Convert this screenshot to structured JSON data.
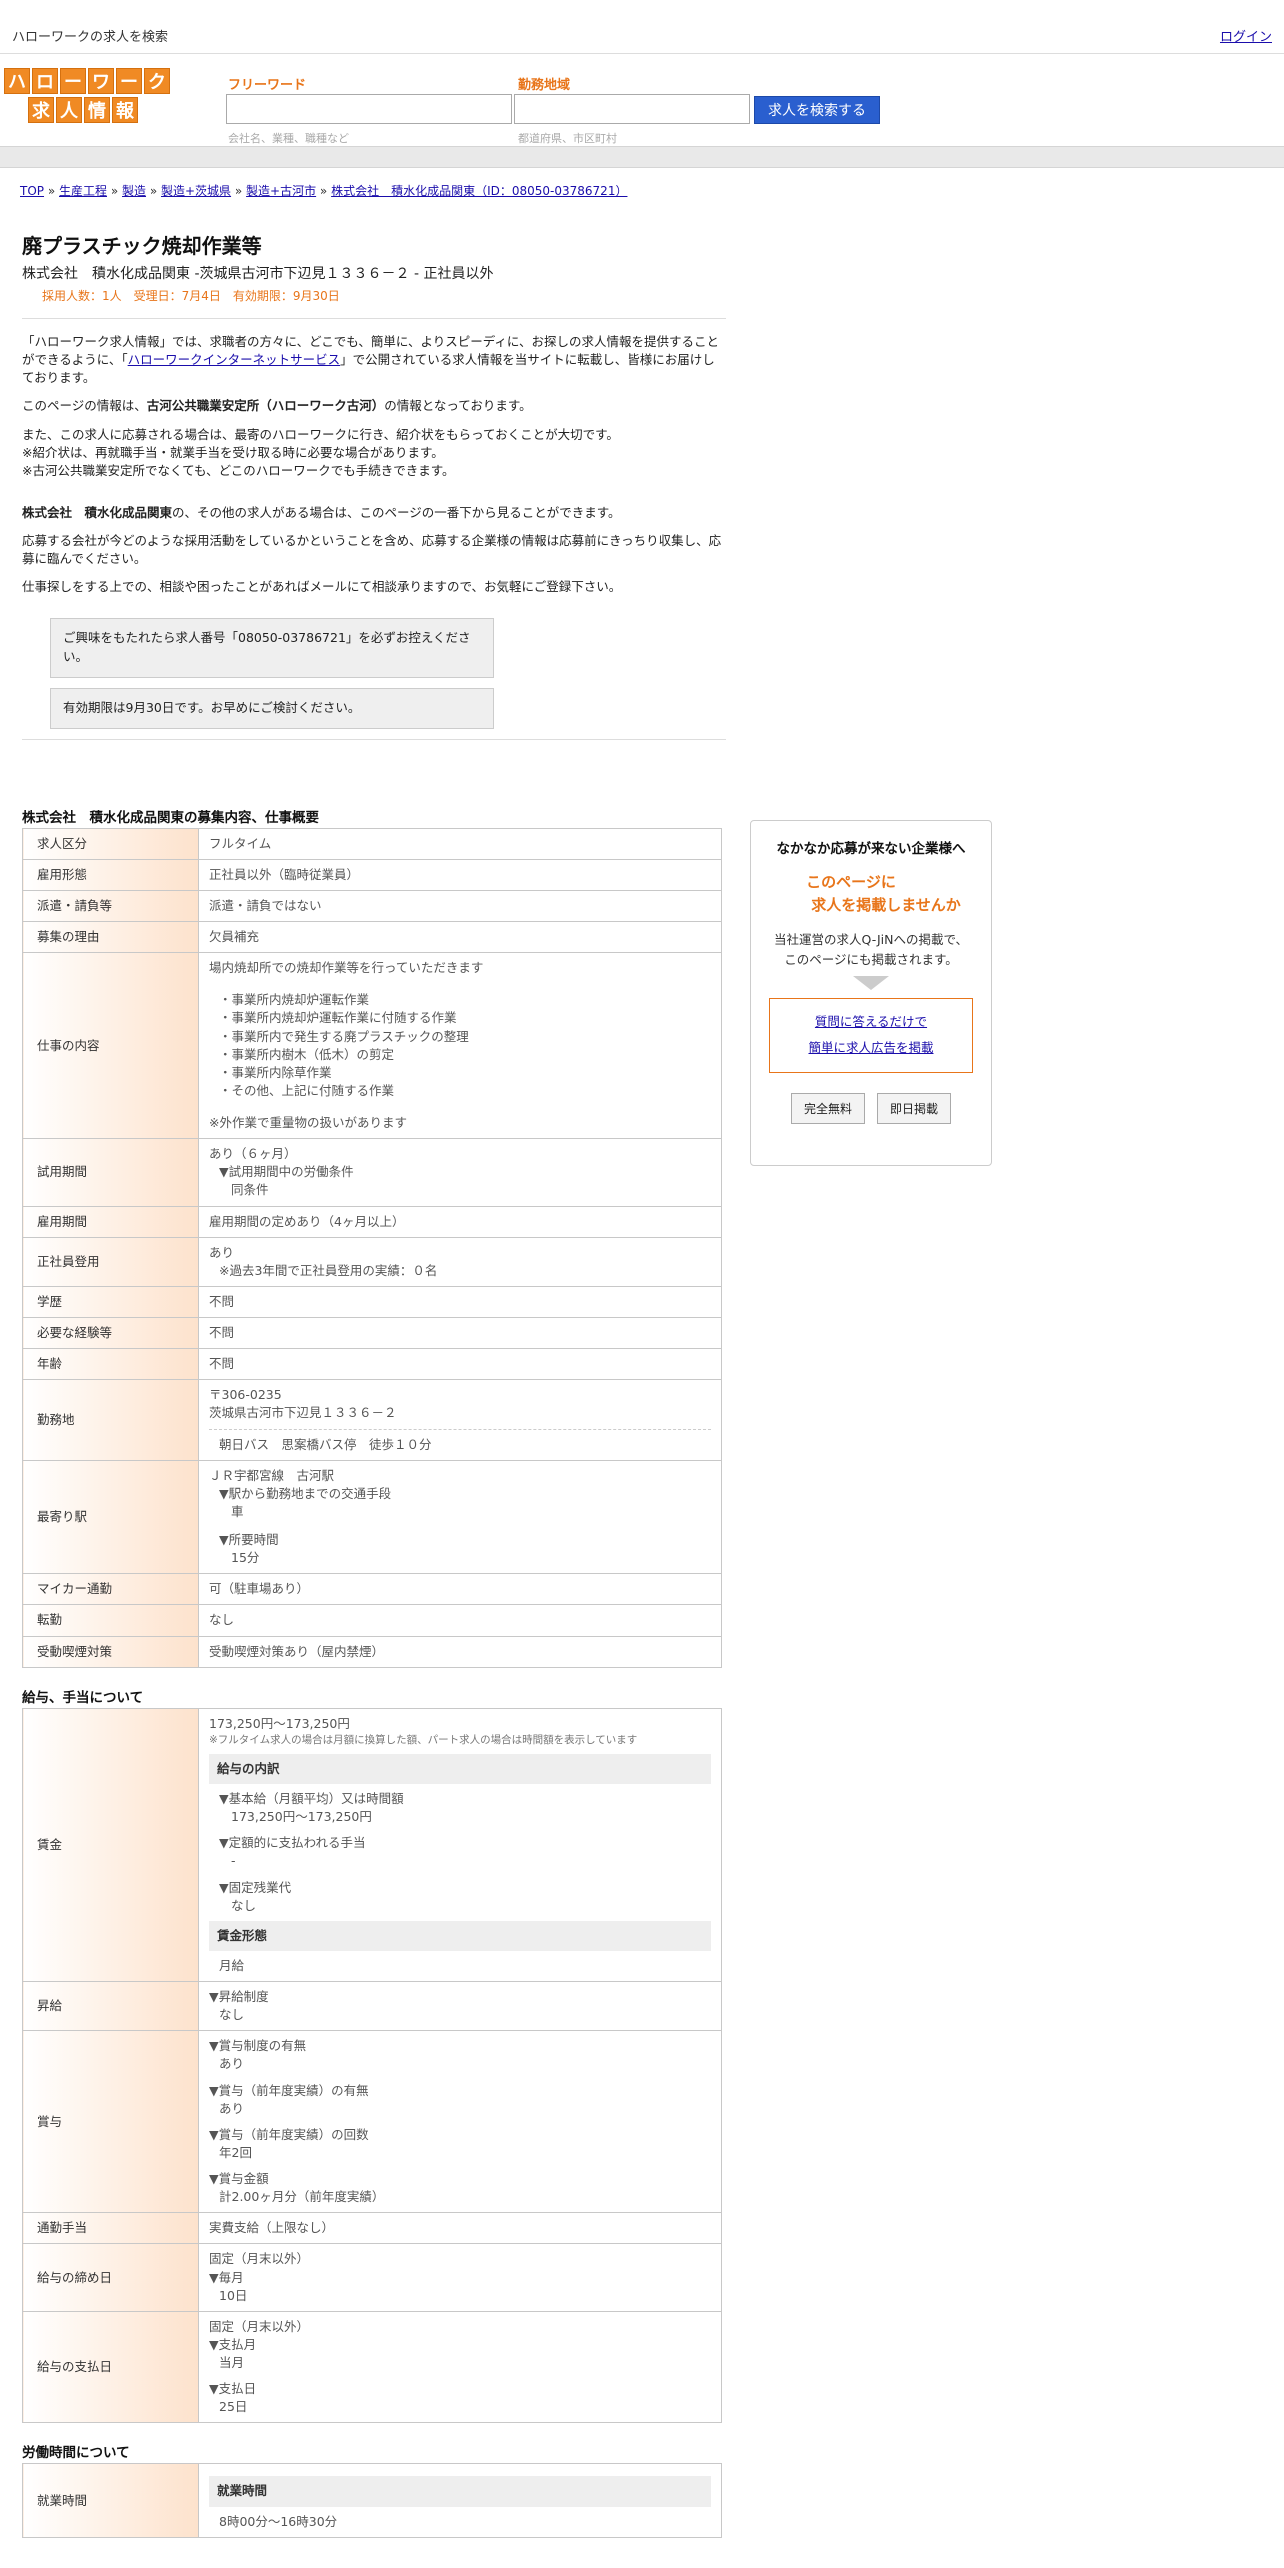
{
  "topbar": {
    "site_title": "ハローワークの求人を検索",
    "login": "ログイン"
  },
  "logo": {
    "row1": [
      "ハ",
      "ロ",
      "ー",
      "ワ",
      "ー",
      "ク"
    ],
    "row2": [
      "求",
      "人",
      "情",
      "報"
    ]
  },
  "search": {
    "freeword_label": "フリーワード",
    "freeword_hint": "会社名、業種、職種など",
    "area_label": "勤務地域",
    "area_hint": "都道府県、市区町村",
    "button": "求人を検索する"
  },
  "breadcrumb": {
    "items": [
      "TOP",
      "生産工程",
      "製造",
      "製造+茨城県",
      "製造+古河市",
      "株式会社　積水化成品関東（ID：08050-03786721）"
    ],
    "sep": " » "
  },
  "job": {
    "title": "廃プラスチック焼却作業等",
    "subtitle": "株式会社　積水化成品関東 -茨城県古河市下辺見１３３６－２ - 正社員以外",
    "meta": "採用人数：1人　受理日：7月4日　有効期限：9月30日"
  },
  "intro": {
    "p1_a": "「ハローワーク求人情報」では、求職者の方々に、どこでも、簡単に、よりスピーディに、お探しの求人情報を提供することができるように、「",
    "p1_link": "ハローワークインターネットサービス",
    "p1_b": "」で公開されている求人情報を当サイトに転載し、皆様にお届けしております。",
    "p2_a": "このページの情報は、",
    "p2_b": "古河公共職業安定所（ハローワーク古河）",
    "p2_c": "の情報となっております。",
    "p3_l1": "また、この求人に応募される場合は、最寄のハローワークに行き、紹介状をもらっておくことが大切です。",
    "p3_l2": "※紹介状は、再就職手当・就業手当を受け取る時に必要な場合があります。",
    "p3_l3": "※古河公共職業安定所でなくても、どこのハローワークでも手続きできます。",
    "p4_a": "株式会社　積水化成品関東",
    "p4_b": "の、その他の求人がある場合は、このページの一番下から見ることができます。",
    "p5": "応募する会社が今どのような採用活動をしているかということを含め、応募する企業様の情報は応募前にきっちり収集し、応募に臨んでください。",
    "p6": "仕事探しをする上での、相談や困ったことがあればメールにて相談承りますので、お気軽にご登録下さい。"
  },
  "notices": [
    "ご興味をもたれたら求人番号「08050-03786721」を必ずお控えください。",
    "有効期限は9月30日です。お早めにご検討ください。"
  ],
  "section1": {
    "title": "株式会社　積水化成品関東の募集内容、仕事概要",
    "rows": [
      {
        "k": "求人区分",
        "v": "フルタイム"
      },
      {
        "k": "雇用形態",
        "v": "正社員以外（臨時従業員）"
      },
      {
        "k": "派遣・請負等",
        "v": "派遣・請負ではない"
      },
      {
        "k": "募集の理由",
        "v": "欠員補充"
      }
    ],
    "job_content_k": "仕事の内容",
    "job_content": {
      "l1": "場内焼却所での焼却作業等を行っていただきます",
      "items": [
        "・事業所内焼却炉運転作業",
        "・事業所内焼却炉運転作業に付随する作業",
        "・事業所内で発生する廃プラスチックの整理",
        "・事業所内樹木（低木）の剪定",
        "・事業所内除草作業",
        "・その他、上記に付随する作業"
      ],
      "note": "※外作業で重量物の扱いがあります"
    },
    "trial_k": "試用期間",
    "trial": {
      "l1": "あり（６ヶ月）",
      "l2": "▼試用期間中の労働条件",
      "l3": "同条件"
    },
    "period_k": "雇用期間",
    "period": "雇用期間の定めあり（4ヶ月以上）",
    "regular_k": "正社員登用",
    "regular": {
      "l1": "あり",
      "l2": "※過去3年間で正社員登用の実績：０名"
    },
    "rows2": [
      {
        "k": "学歴",
        "v": "不問"
      },
      {
        "k": "必要な経験等",
        "v": "不問"
      },
      {
        "k": "年齢",
        "v": "不問"
      }
    ],
    "location_k": "勤務地",
    "location": {
      "zip": "〒306-0235",
      "addr": "茨城県古河市下辺見１３３６－２",
      "bus": "朝日バス　思案橋バス停　徒歩１０分"
    },
    "station_k": "最寄り駅",
    "station": {
      "l1": "ＪＲ宇都宮線　古河駅",
      "l2": "▼駅から勤務地までの交通手段",
      "l3": "車",
      "l4": "▼所要時間",
      "l5": "15分"
    },
    "rows3": [
      {
        "k": "マイカー通勤",
        "v": "可（駐車場あり）"
      },
      {
        "k": "転勤",
        "v": "なし"
      },
      {
        "k": "受動喫煙対策",
        "v": "受動喫煙対策あり（屋内禁煙）"
      }
    ]
  },
  "section2": {
    "title": "給与、手当について",
    "wage_k": "賃金",
    "wage": {
      "range": "173,250円〜173,250円",
      "note": "※フルタイム求人の場合は月額に換算した額、パート求人の場合は時間額を表示しています",
      "breakdown_h": "給与の内訳",
      "b1": "▼基本給（月額平均）又は時間額",
      "b1v": "173,250円〜173,250円",
      "b2": "▼定額的に支払われる手当",
      "b2v": "-",
      "b3": "▼固定残業代",
      "b3v": "なし",
      "form_h": "賃金形態",
      "form": "月給"
    },
    "raise_k": "昇給",
    "raise": {
      "l1": "▼昇給制度",
      "l2": "なし"
    },
    "bonus_k": "賞与",
    "bonus": {
      "l1": "▼賞与制度の有無",
      "l1v": "あり",
      "l2": "▼賞与（前年度実績）の有無",
      "l2v": "あり",
      "l3": "▼賞与（前年度実績）の回数",
      "l3v": "年2回",
      "l4": "▼賞与金額",
      "l4v": "計2.00ヶ月分（前年度実績）"
    },
    "commute_k": "通勤手当",
    "commute": "実費支給（上限なし）",
    "closing_k": "給与の締め日",
    "closing": {
      "l1": "固定（月末以外）",
      "l2": "▼毎月",
      "l3": "10日"
    },
    "payday_k": "給与の支払日",
    "payday": {
      "l1": "固定（月末以外）",
      "l2": "▼支払月",
      "l3": "当月",
      "l4": "▼支払日",
      "l5": "25日"
    }
  },
  "section3": {
    "title": "労働時間について",
    "hours_k": "就業時間",
    "hours_h": "就業時間",
    "hours": "8時00分〜16時30分"
  },
  "side": {
    "heading": "なかなか応募が来ない企業様へ",
    "orange_l1": "このページに",
    "orange_l2": "求人を掲載しませんか",
    "text_l1": "当社運営の求人Q-JiNへの掲載で、",
    "text_l2": "このページにも掲載されます。",
    "link1": "質問に答えるだけで",
    "link2": "簡単に求人広告を掲載",
    "btn1": "完全無料",
    "btn2": "即日掲載"
  }
}
